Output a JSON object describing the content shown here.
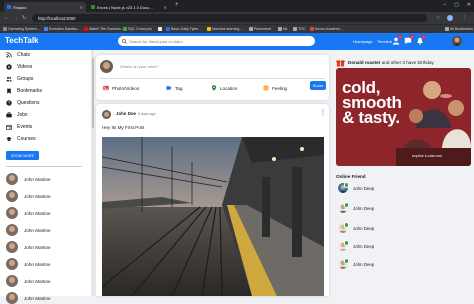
{
  "browser": {
    "tabs": [
      {
        "title": "Fbapko",
        "active": true
      },
      {
        "title": "Errors | Node.js v23.1.0 Docu…",
        "active": false
      }
    ],
    "new_tab": "+",
    "url": "http://localhost:3000",
    "bookmarks": [
      "Operating System…",
      "Evolution Handbo…",
      "Watch The Success…",
      "SQL Cross join",
      "",
      "Basic Daily Tylen…",
      "Machine learning…",
      "Placement",
      "ML",
      "TOC",
      "Incom Academi…",
      "All Bookmarks"
    ]
  },
  "app": {
    "logo": "TechTalk",
    "search_placeholder": "Search for friend post or video",
    "nav_links": [
      "Homepage",
      "Timeline"
    ],
    "notifications": {
      "user": "1",
      "chat": "2",
      "bell": "1"
    }
  },
  "sidebar": {
    "items": [
      {
        "label": "Chats",
        "icon": "rss-icon"
      },
      {
        "label": "Videos",
        "icon": "play-icon"
      },
      {
        "label": "Groups",
        "icon": "group-icon"
      },
      {
        "label": "Bookmarks",
        "icon": "bookmark-icon"
      },
      {
        "label": "Questions",
        "icon": "help-icon"
      },
      {
        "label": "Jobs",
        "icon": "briefcase-icon"
      },
      {
        "label": "Events",
        "icon": "calendar-icon"
      },
      {
        "label": "Courses",
        "icon": "school-icon"
      }
    ],
    "show_more": "SHOW MORE",
    "friends": [
      "John Martine",
      "John Martine",
      "John Martine",
      "John Martine",
      "John Martine",
      "John Martine",
      "John Martine",
      "John Martine"
    ]
  },
  "share": {
    "placeholder": "What's on your mind?",
    "options": [
      {
        "label": "Photo/Videos",
        "icon": "photo-icon",
        "color": "#e53935"
      },
      {
        "label": "Tag",
        "icon": "label-icon",
        "color": "#1877f2"
      },
      {
        "label": "Location",
        "icon": "location-icon",
        "color": "#2e7d32"
      },
      {
        "label": "Feeling",
        "icon": "emoji-icon",
        "color": "#f9a825"
      }
    ],
    "button": "Share"
  },
  "post": {
    "author": "John Doe",
    "date": "5 days ago",
    "text": "Hey Its My First Post"
  },
  "rightbar": {
    "birthday_name": "Donald roaster",
    "birthday_rest": "and other 3 have birthday",
    "ad_text_lines": [
      "cold,",
      "smooth",
      "& tasty."
    ],
    "ad_sub": "explore k-cola.com",
    "online_title": "Online Friend",
    "online": [
      "John Deep",
      "John Deep",
      "John Deep",
      "John Deep",
      "John Deep"
    ]
  },
  "colors": {
    "primary": "#1877f2",
    "online": "#31a24c",
    "badge": "#e41e3f"
  }
}
